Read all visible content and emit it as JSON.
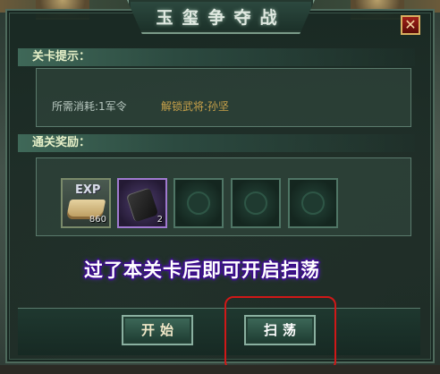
{
  "dialog": {
    "title": "玉玺争夺战",
    "close_label": "✕"
  },
  "hint_section": {
    "header": "关卡提示：",
    "cost_text": "所需消耗:1军令",
    "unlock_text": "解锁武将:孙坚"
  },
  "reward_section": {
    "header": "通关奖励：",
    "slots": [
      {
        "icon": "exp-book-icon",
        "label": "EXP",
        "count": "860"
      },
      {
        "icon": "military-token-icon",
        "count": "2"
      },
      {
        "icon": "empty-slot"
      },
      {
        "icon": "empty-slot"
      },
      {
        "icon": "empty-slot"
      }
    ]
  },
  "banner_text": "过了本关卡后即可开启扫荡",
  "buttons": {
    "start": "开始",
    "sweep": "扫荡"
  },
  "colors": {
    "highlight_border": "#d01818",
    "unlock_text": "#c9a24a",
    "banner_outline": "#3a0a8a"
  }
}
